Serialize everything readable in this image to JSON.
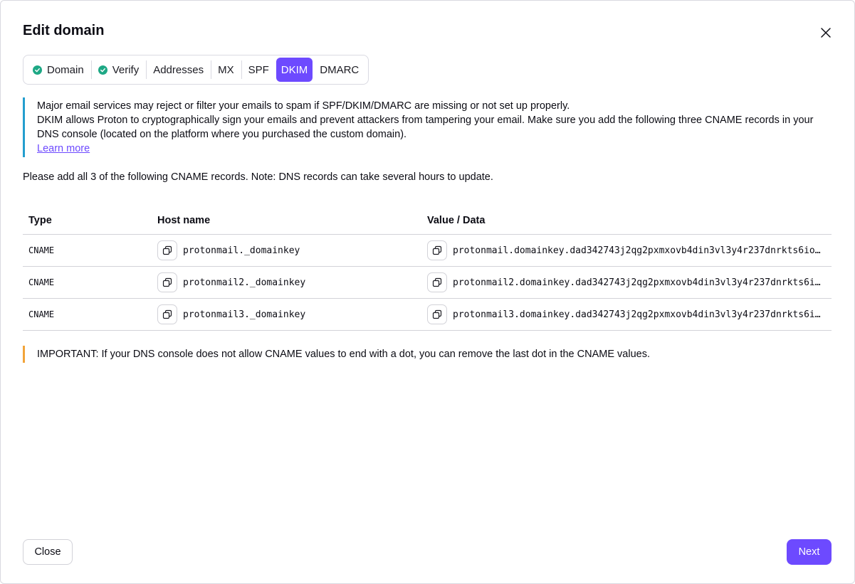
{
  "modal": {
    "title": "Edit domain"
  },
  "tabs": [
    {
      "label": "Domain",
      "checked": true,
      "active": false
    },
    {
      "label": "Verify",
      "checked": true,
      "active": false
    },
    {
      "label": "Addresses",
      "checked": false,
      "active": false
    },
    {
      "label": "MX",
      "checked": false,
      "active": false
    },
    {
      "label": "SPF",
      "checked": false,
      "active": false
    },
    {
      "label": "DKIM",
      "checked": false,
      "active": true
    },
    {
      "label": "DMARC",
      "checked": false,
      "active": false
    }
  ],
  "info": {
    "line1": "Major email services may reject or filter your emails to spam if SPF/DKIM/DMARC are missing or not set up properly.",
    "line2": "DKIM allows Proton to cryptographically sign your emails and prevent attackers from tampering your email. Make sure you add the following three CNAME records in your DNS console (located on the platform where you purchased the custom domain).",
    "learn_more": "Learn more"
  },
  "note": "Please add all 3 of the following CNAME records. Note: DNS records can take several hours to update.",
  "table": {
    "headers": {
      "type": "Type",
      "host": "Host name",
      "value": "Value / Data"
    },
    "rows": [
      {
        "type": "CNAME",
        "host": "protonmail._domainkey",
        "value": "protonmail.domainkey.dad342743j2qg2pxmxovb4din3vl3y4r237dnrkts6io…"
      },
      {
        "type": "CNAME",
        "host": "protonmail2._domainkey",
        "value": "protonmail2.domainkey.dad342743j2qg2pxmxovb4din3vl3y4r237dnrkts6i…"
      },
      {
        "type": "CNAME",
        "host": "protonmail3._domainkey",
        "value": "protonmail3.domainkey.dad342743j2qg2pxmxovb4din3vl3y4r237dnrkts6i…"
      }
    ]
  },
  "warning": "IMPORTANT: If your DNS console does not allow CNAME values to end with a dot, you can remove the last dot in the CNAME values.",
  "footer": {
    "close_label": "Close",
    "next_label": "Next"
  },
  "icons": {
    "close": "close-icon",
    "check": "check-circle-icon",
    "copy": "copy-icon"
  },
  "colors": {
    "accent": "#6d4aff",
    "success": "#1ea885",
    "info_border": "#239ece",
    "warning_border": "#f2a43a"
  }
}
